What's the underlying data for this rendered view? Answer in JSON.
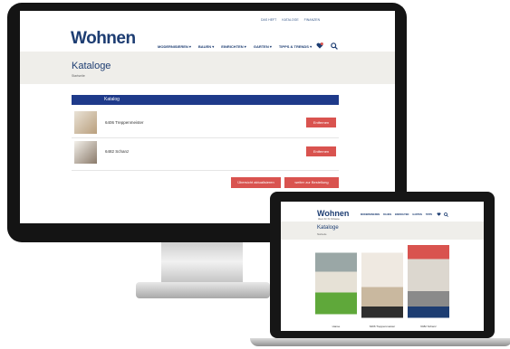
{
  "desktop": {
    "top_links": [
      "DAS HEFT",
      "KATALOGE",
      "FINANZEN"
    ],
    "logo": "Wohnen",
    "tagline": "Ideen für Ihr Zuhause",
    "nav": [
      "MODERNISIEREN ▾",
      "BAUEN ▾",
      "EINRICHTEN ▾",
      "GARTEN ▾",
      "TIPPS & TRENDS ▾"
    ],
    "page_title": "Kataloge",
    "breadcrumb": "Startseite",
    "table_header": "Katalog",
    "rows": [
      {
        "label": "6406 Treppenmeister",
        "remove": "Entfernen"
      },
      {
        "label": "6482 Schanz",
        "remove": "Entfernen"
      }
    ],
    "update_button": "Übersicht aktualisieren",
    "next_button": "weiter zur Bestellung"
  },
  "laptop": {
    "logo": "Wohnen",
    "tagline": "Ideen für Ihr Zuhause",
    "nav": [
      "MODERNISIEREN",
      "BAUEN",
      "EINRICHTEN",
      "GARTEN",
      "TIPPS"
    ],
    "page_title": "Kataloge",
    "breadcrumb": "Startseite",
    "covers": [
      {
        "label": "Hanse"
      },
      {
        "label": "6406 Treppenmeister"
      },
      {
        "label": "6482 Schanz"
      }
    ]
  },
  "colors": {
    "brand": "#1d3d72",
    "accent": "#d9534f",
    "table_header": "#1e3a8a"
  }
}
